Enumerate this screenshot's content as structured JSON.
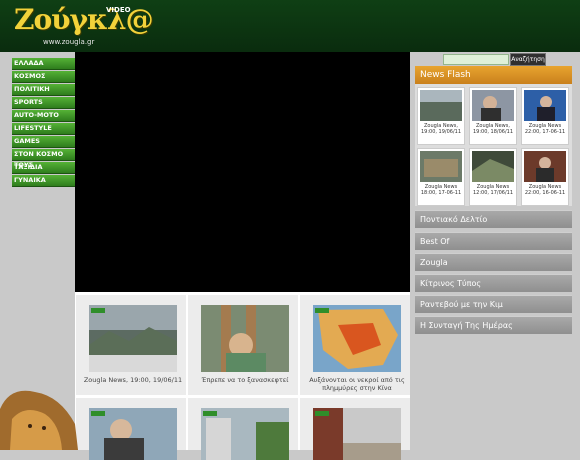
{
  "header": {
    "logo_text": "Ζούγκλ@",
    "logo_badge": "VIDEO",
    "logo_url": "www.zougla.gr"
  },
  "search": {
    "placeholder": "",
    "button_label": "Αναζήτηση"
  },
  "menu": [
    "ΕΛΛΑΔΑ",
    "ΚΟΣΜΟΣ",
    "ΠΟΛΙΤΙΚΗ",
    "SPORTS",
    "AUTO-MOTO",
    "LIFESTYLE",
    "GAMES",
    "ΣΤΟΝ ΚΟΣΜΟ ΤΟΥΣ",
    "ΤΑΞΙΔΙΑ",
    "ΓΥΝΑΙΚΑ"
  ],
  "video_grid": [
    {
      "caption": "Zougla News, 19:00, 19/06/11"
    },
    {
      "caption": "Έπρεπε να το ξανασκεφτεί"
    },
    {
      "caption": "Αυξάνονται οι νεκροί από τις πλημμύρες στην Κίνα"
    },
    {
      "caption": ""
    },
    {
      "caption": ""
    },
    {
      "caption": ""
    }
  ],
  "news_flash": {
    "title": "News Flash",
    "items": [
      {
        "caption": "Zougla News, 19:00, 19/06/11"
      },
      {
        "caption": "Zougla News, 19:00, 18/06/11"
      },
      {
        "caption": "Zougla News 22:00, 17-06-11"
      },
      {
        "caption": "Zougla News 18:00, 17-06-11"
      },
      {
        "caption": "Zougla News 12:00, 17/06/11"
      },
      {
        "caption": "Zougla News 22:00, 16-06-11"
      }
    ]
  },
  "categories": [
    "Ποντιακό Δελτίο",
    "Best Of",
    "Zougla",
    "Κίτρινος Τύπος",
    "Ραντεβού με την Κιμ",
    "Η Συνταγή Της Ημέρας"
  ]
}
